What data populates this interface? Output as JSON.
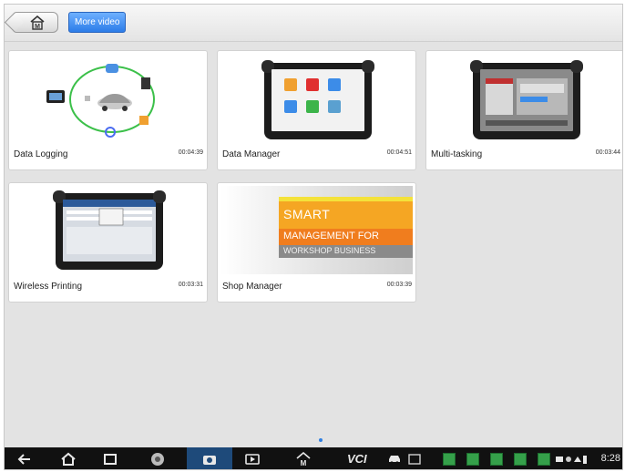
{
  "topbar": {
    "home_icon": "home-m-icon",
    "tab_label": "More video"
  },
  "videos": [
    {
      "title": "Data Logging",
      "duration": "00:04:39"
    },
    {
      "title": "Data Manager",
      "duration": "00:04:51"
    },
    {
      "title": "Multi-tasking",
      "duration": "00:03:44"
    },
    {
      "title": "Wireless Printing",
      "duration": "00:03:31"
    },
    {
      "title": "Shop Manager",
      "duration": "00:03:39"
    }
  ],
  "shop_manager_banner": {
    "line1": "SMART",
    "line2": "MANAGEMENT FOR",
    "line3": "WORKSHOP BUSINESS"
  },
  "navbar": {
    "icons": [
      "back-icon",
      "home-icon",
      "recent-apps-icon",
      "chrome-icon",
      "camera-icon",
      "video-app-icon",
      "maxisys-home-icon",
      "vci-icon",
      "car-icon",
      "notification-icon"
    ],
    "vci_label": "VCI",
    "clock": "8:28"
  },
  "colors": {
    "accent": "#2c7ce8",
    "navbar": "#111111",
    "background": "#e3e3e3"
  }
}
